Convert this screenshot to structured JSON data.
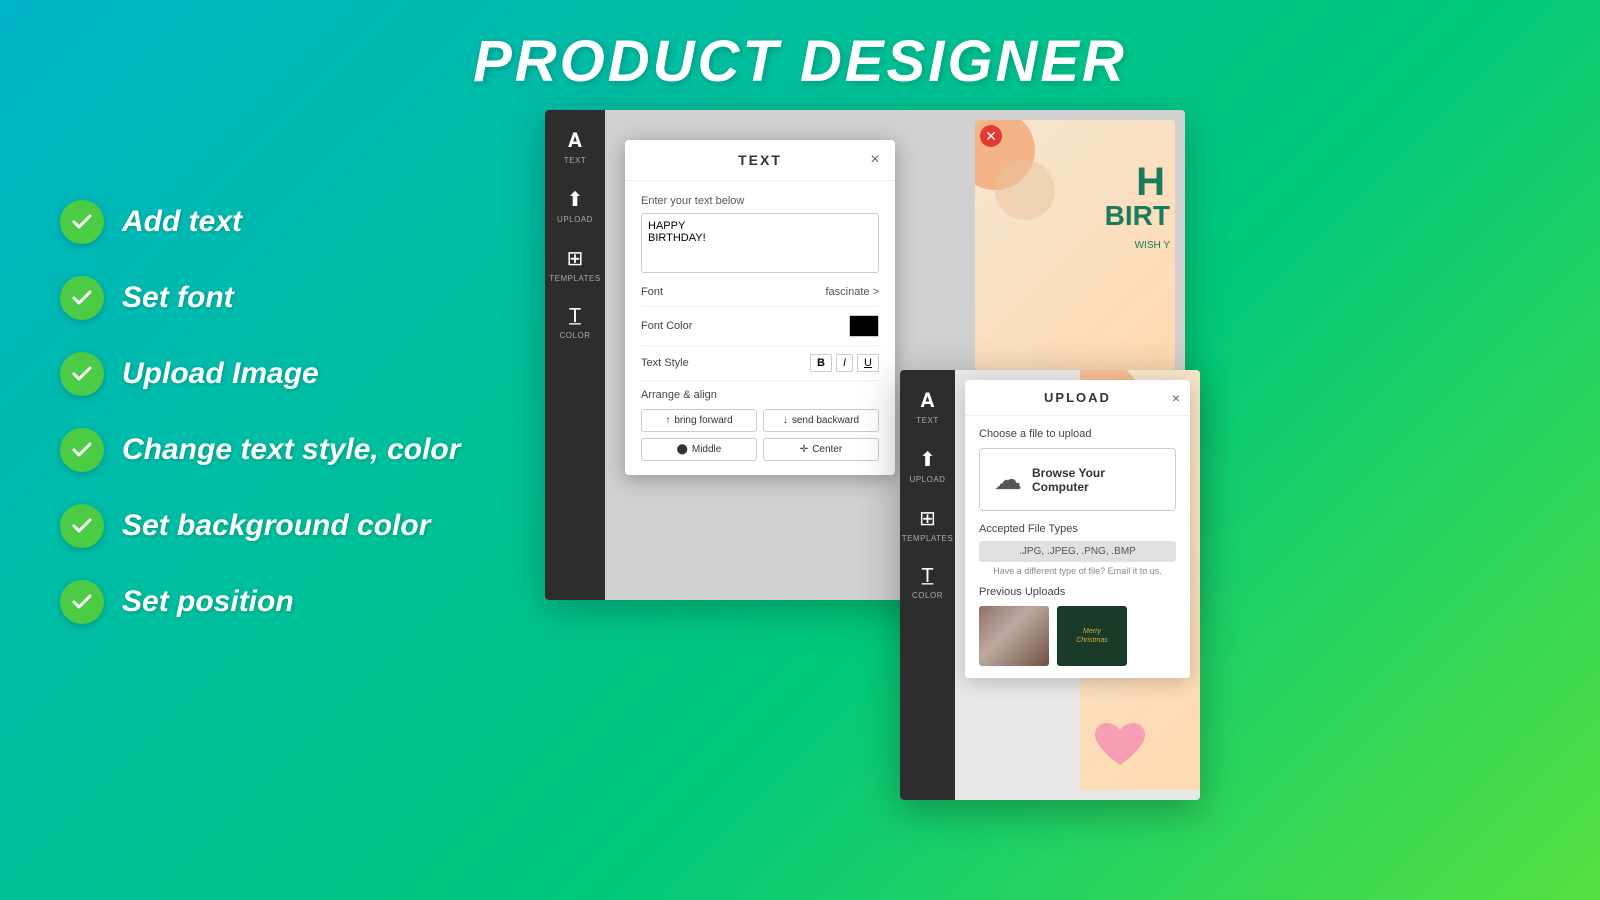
{
  "page": {
    "title": "PRODUCT DESIGNER",
    "bg_gradient_start": "#00b4c8",
    "bg_gradient_end": "#55e040"
  },
  "features": [
    {
      "id": "add-text",
      "label": "Add text"
    },
    {
      "id": "set-font",
      "label": "Set font"
    },
    {
      "id": "upload-image",
      "label": "Upload Image"
    },
    {
      "id": "change-style",
      "label": "Change text style, color"
    },
    {
      "id": "bg-color",
      "label": "Set background color"
    },
    {
      "id": "set-position",
      "label": "Set position"
    }
  ],
  "sidebar": {
    "items": [
      {
        "id": "text",
        "icon": "A",
        "label": "TEXT"
      },
      {
        "id": "upload",
        "icon": "⬆",
        "label": "UPLOAD"
      },
      {
        "id": "templates",
        "icon": "⊞",
        "label": "TEMPLATES"
      },
      {
        "id": "color",
        "icon": "T",
        "label": "COLOR"
      }
    ]
  },
  "text_modal": {
    "title": "TEXT",
    "close_label": "×",
    "enter_text_label": "Enter your text below",
    "textarea_value": "HAPPY\nBIRTHDAY!",
    "font_label": "Font",
    "font_value": "fascinate >",
    "font_color_label": "Font Color",
    "text_style_label": "Text Style",
    "bold_label": "B",
    "italic_label": "I",
    "underline_label": "U",
    "arrange_label": "Arrange & align",
    "bring_forward_label": "bring forward",
    "send_backward_label": "send backward",
    "middle_label": "Middle",
    "center_label": "Center"
  },
  "upload_modal": {
    "title": "UPLOAD",
    "close_label": "×",
    "choose_label": "Choose a file to upload",
    "browse_label": "Browse Your Computer",
    "accepted_label": "Accepted File Types",
    "accepted_types": ".JPG, .JPEG, .PNG, .BMP",
    "email_note": "Have a different type of file? Email it to us.",
    "prev_uploads_label": "Previous Uploads",
    "prev_upload_1_alt": "Photo upload 1",
    "prev_upload_2_alt": "Christmas card"
  },
  "card_preview": {
    "h_text": "H",
    "birt_text": "BIRT",
    "wish_text": "WISH Y"
  }
}
